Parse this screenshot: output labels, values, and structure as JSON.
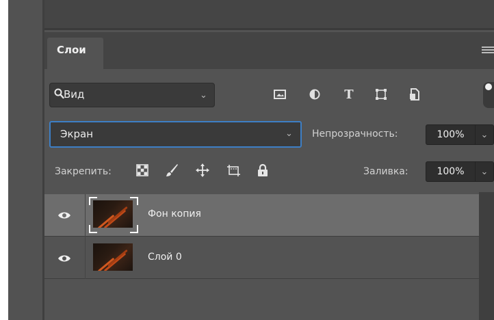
{
  "panel": {
    "tab_label": "Слои"
  },
  "filter": {
    "label": "Вид",
    "icons": [
      "search-icon",
      "image-filter-icon",
      "adjustment-filter-icon",
      "type-filter-icon",
      "shape-filter-icon",
      "smart-object-filter-icon"
    ]
  },
  "blend": {
    "mode": "Экран",
    "opacity_label": "Непрозрачность:",
    "opacity_value": "100%"
  },
  "lock": {
    "label": "Закрепить:",
    "icons": [
      "lock-transparent-pixels-icon",
      "lock-image-pixels-icon",
      "lock-position-icon",
      "lock-artboard-icon",
      "lock-all-icon"
    ],
    "fill_label": "Заливка:",
    "fill_value": "100%"
  },
  "layers": [
    {
      "name": "Фон копия",
      "selected": true,
      "visible": true
    },
    {
      "name": "Слой 0",
      "selected": false,
      "visible": true
    }
  ],
  "colors": {
    "panel_bg": "#535353",
    "selected_row": "#6d6d6d",
    "focus_border": "#3d7fc6"
  }
}
